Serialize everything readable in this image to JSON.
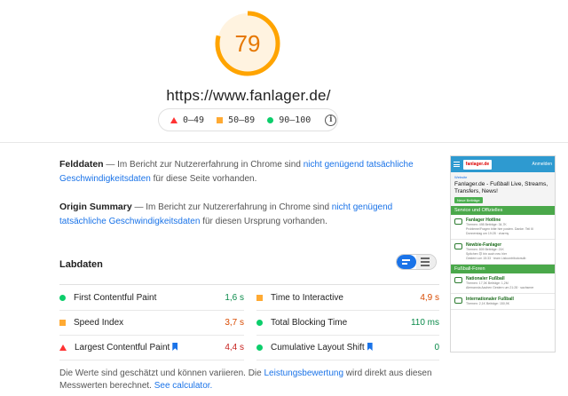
{
  "score": {
    "value": "79",
    "fraction": 0.79,
    "color": "#ffa400"
  },
  "url": "https://www.fanlager.de/",
  "legend": [
    {
      "shape": "triangle",
      "label": "0–49",
      "color": "#ff3333"
    },
    {
      "shape": "square",
      "label": "50–89",
      "color": "#ffaa33"
    },
    {
      "shape": "circle",
      "label": "90–100",
      "color": "#0cce6b"
    }
  ],
  "field": {
    "title": "Felddaten",
    "text_before": "— Im Bericht zur Nutzererfahrung in Chrome sind",
    "link": "nicht genügend tatsächliche Geschwindigkeitsdaten",
    "text_after": "für diese Seite vorhanden."
  },
  "origin": {
    "title": "Origin Summary",
    "text_before": "— Im Bericht zur Nutzererfahrung in Chrome sind",
    "link": "nicht genügend tatsächliche Geschwindigkeitsdaten",
    "text_after": "für diesen Ursprung vorhanden."
  },
  "lab": {
    "title": "Labdaten",
    "metrics_left": [
      {
        "label": "First Contentful Paint",
        "value": "1,6 s",
        "status": "pass"
      },
      {
        "label": "Speed Index",
        "value": "3,7 s",
        "status": "average"
      },
      {
        "label": "Largest Contentful Paint",
        "value": "4,4 s",
        "status": "fail",
        "bookmark": true
      }
    ],
    "metrics_right": [
      {
        "label": "Time to Interactive",
        "value": "4,9 s",
        "status": "average"
      },
      {
        "label": "Total Blocking Time",
        "value": "110 ms",
        "status": "pass"
      },
      {
        "label": "Cumulative Layout Shift",
        "value": "0",
        "status": "pass",
        "bookmark": true
      }
    ]
  },
  "footnote": {
    "text1": "Die Werte sind geschätzt und können variieren. Die",
    "link1": "Leistungsbewertung",
    "text2": "wird direkt aus diesen Messwerten berechnet.",
    "link2": "See calculator."
  },
  "phone": {
    "logo": "fanlager.de",
    "login": "Anmelden",
    "crumb": "Website",
    "title": "Fanlager.de - Fußball Live, Streams, Transfers, News!",
    "button": "Neue Beiträge",
    "sections": [
      {
        "name": "Service und Offizielles",
        "rows": [
          {
            "title": "Fanlager Hotline",
            "sub": "Themen: 498 Beiträge: 34,7K",
            "sub2": "Probleme/Fragen bitte hier posten. Danke. Teil III",
            "sub3": "Donnerstag um 19:28 · charmy"
          },
          {
            "title": "Newbie-Fanlager",
            "sub": "Themen: 809 Beiträge: 21K",
            "sub2": "Spitchen 😊 bin auch neu hier",
            "sub3": "Gestern um 15:33 · team Listcontributorsdb"
          }
        ]
      },
      {
        "name": "Fußball-Foren",
        "rows": [
          {
            "title": "Nationaler Fußball",
            "sub": "Themen: 17,3K Beiträge: 1,2M",
            "sub2": "Alemannia Aachen Gestern um 21:28 · sachsmer",
            "sub3": ""
          },
          {
            "title": "Internationaler Fußball",
            "sub": "Themen: 2,1K Beiträge: 150,9K",
            "sub2": "",
            "sub3": ""
          }
        ]
      }
    ]
  }
}
